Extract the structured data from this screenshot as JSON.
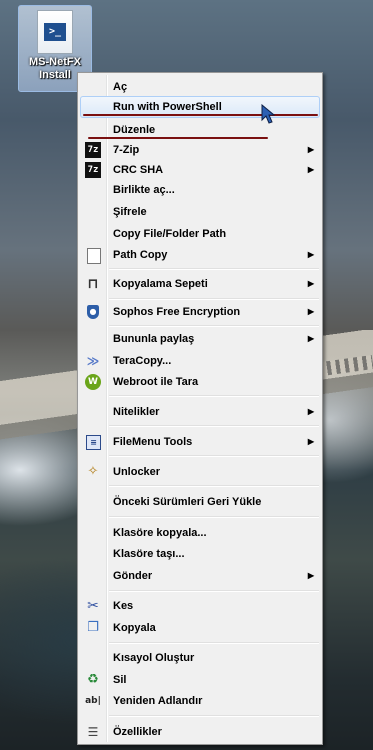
{
  "desktop": {
    "icon_label_line1": "MS-NetFX",
    "icon_label_line2": "Install",
    "icon_glyph": "powershell-script-icon"
  },
  "menu": {
    "items": [
      {
        "id": "open",
        "label": "Aç",
        "icon": "",
        "submenu": false
      },
      {
        "id": "run-powershell",
        "label": "Run with PowerShell",
        "icon": "",
        "submenu": false,
        "highlighted": true
      },
      {
        "id": "edit",
        "label": "Düzenle",
        "icon": "",
        "submenu": false
      },
      {
        "id": "7zip",
        "label": "7-Zip",
        "icon": "7z-icon",
        "submenu": true
      },
      {
        "id": "crc-sha",
        "label": "CRC SHA",
        "icon": "7z-icon",
        "submenu": true
      },
      {
        "id": "open-with",
        "label": "Birlikte aç...",
        "icon": "",
        "submenu": false
      },
      {
        "id": "encrypt",
        "label": "Şifrele",
        "icon": "",
        "submenu": false
      },
      {
        "id": "copy-path",
        "label": "Copy File/Folder Path",
        "icon": "",
        "submenu": false
      },
      {
        "id": "path-copy",
        "label": "Path Copy",
        "icon": "document-icon",
        "submenu": true
      },
      {
        "id": "copy-basket",
        "label": "Kopyalama Sepeti",
        "icon": "basket-icon",
        "submenu": true
      },
      {
        "id": "sophos",
        "label": "Sophos Free Encryption",
        "icon": "shield-icon",
        "submenu": true
      },
      {
        "id": "share-with",
        "label": "Bununla paylaş",
        "icon": "",
        "submenu": true
      },
      {
        "id": "teracopy",
        "label": "TeraCopy...",
        "icon": "teracopy-icon",
        "submenu": false
      },
      {
        "id": "webroot",
        "label": "Webroot ile Tara",
        "icon": "webroot-icon",
        "submenu": false
      },
      {
        "id": "attributes",
        "label": "Nitelikler",
        "icon": "",
        "submenu": true
      },
      {
        "id": "filemenu-tools",
        "label": "FileMenu Tools",
        "icon": "filemenu-icon",
        "submenu": true
      },
      {
        "id": "unlocker",
        "label": "Unlocker",
        "icon": "wand-icon",
        "submenu": false
      },
      {
        "id": "restore-previous",
        "label": "Önceki Sürümleri Geri Yükle",
        "icon": "",
        "submenu": false
      },
      {
        "id": "copy-to-folder",
        "label": "Klasöre kopyala...",
        "icon": "",
        "submenu": false
      },
      {
        "id": "move-to-folder",
        "label": "Klasöre taşı...",
        "icon": "",
        "submenu": false
      },
      {
        "id": "send-to",
        "label": "Gönder",
        "icon": "",
        "submenu": true
      },
      {
        "id": "cut",
        "label": "Kes",
        "icon": "scissors-icon",
        "submenu": false
      },
      {
        "id": "copy",
        "label": "Kopyala",
        "icon": "copy-icon",
        "submenu": false
      },
      {
        "id": "create-shortcut",
        "label": "Kısayol Oluştur",
        "icon": "",
        "submenu": false
      },
      {
        "id": "delete",
        "label": "Sil",
        "icon": "recycle-icon",
        "submenu": false
      },
      {
        "id": "rename",
        "label": "Yeniden Adlandır",
        "icon": "rename-icon",
        "submenu": false
      },
      {
        "id": "properties",
        "label": "Özellikler",
        "icon": "properties-icon",
        "submenu": false
      }
    ]
  },
  "colors": {
    "menu_bg": "#f0f0f0",
    "highlight_border": "#aecff7",
    "annotation_line": "#7a1010"
  }
}
